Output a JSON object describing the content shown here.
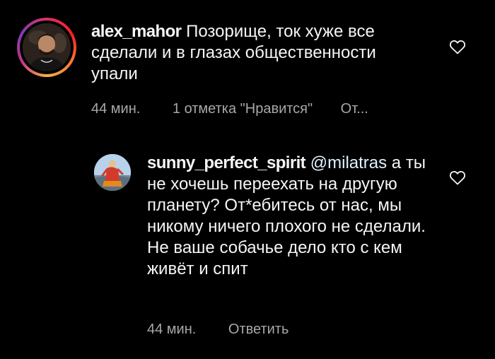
{
  "comments": [
    {
      "username": "alex_mahor",
      "text": "Позорище, ток хуже все сделали и в глазах общественности упали",
      "time": "44 мин.",
      "likes": "1 отметка \"Нравится\"",
      "reply": "От..."
    },
    {
      "username": "sunny_perfect_spirit",
      "mention": "@milatras",
      "text": "а ты не хочешь переехать на другую планету? От*ебитесь от нас, мы никому ничего плохого не сделали. Не ваше собачье дело кто с кем живёт и спит",
      "time": "44 мин.",
      "reply": "Ответить"
    }
  ],
  "icons": {
    "like": "heart-outline-icon"
  },
  "colors": {
    "background": "#000000",
    "text": "#f5f5f5",
    "meta": "#a8a8a8"
  }
}
